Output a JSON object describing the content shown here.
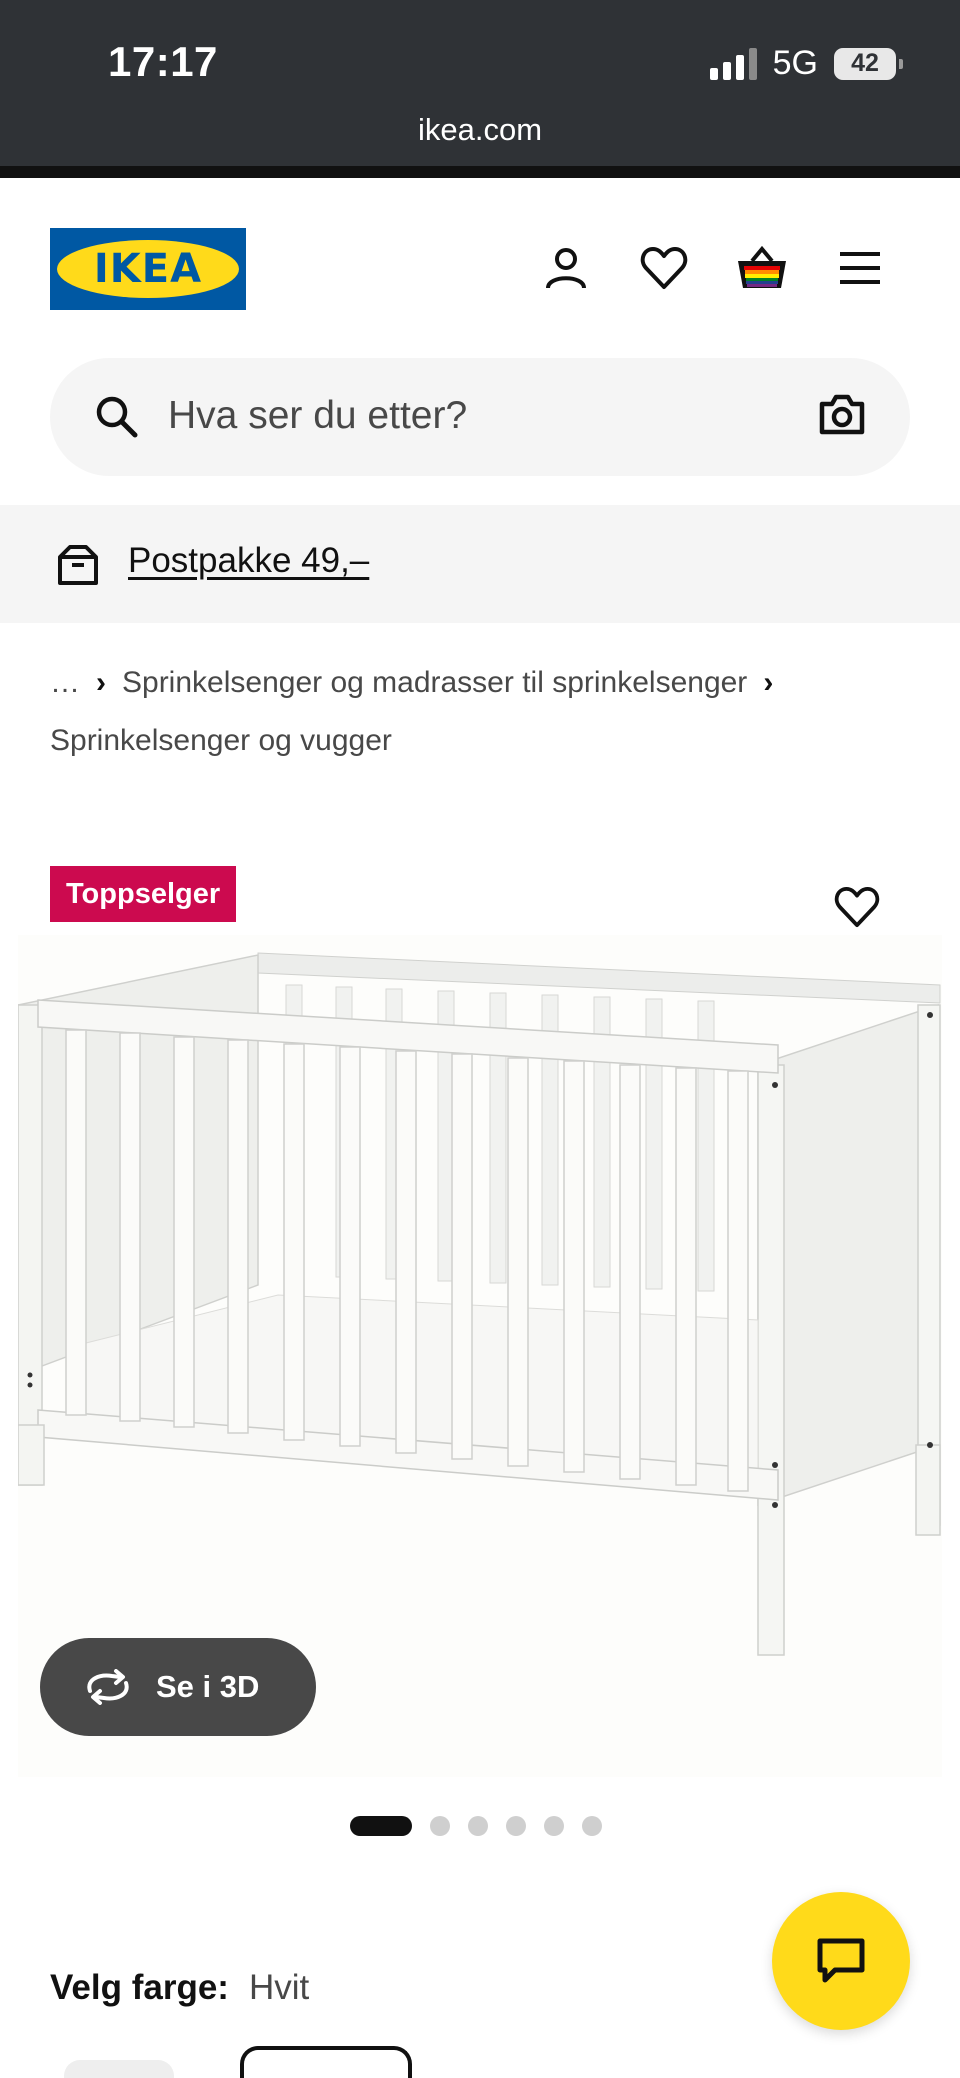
{
  "status_bar": {
    "time": "17:17",
    "network": "5G",
    "battery": "42",
    "url": "ikea.com"
  },
  "header": {
    "logo_text": "IKEA",
    "brand_blue": "#0058a3",
    "brand_yellow": "#ffda1a",
    "icons": [
      "user-icon",
      "heart-icon",
      "basket-icon",
      "menu-icon"
    ]
  },
  "search": {
    "placeholder": "Hva ser du etter?"
  },
  "banner": {
    "link_text": "Postpakke 49,–"
  },
  "breadcrumb": {
    "ellipsis": "…",
    "item1": "Sprinkelsenger og madrasser til sprinkelsenger",
    "item2": "Sprinkelsenger og vugger"
  },
  "product": {
    "badge": "Toppselger",
    "badge_color": "#cc0a4f",
    "view_3d_label": "Se i 3D",
    "image_count": 6,
    "active_image": 1
  },
  "color_selector": {
    "label": "Velg farge:",
    "value": "Hvit"
  }
}
